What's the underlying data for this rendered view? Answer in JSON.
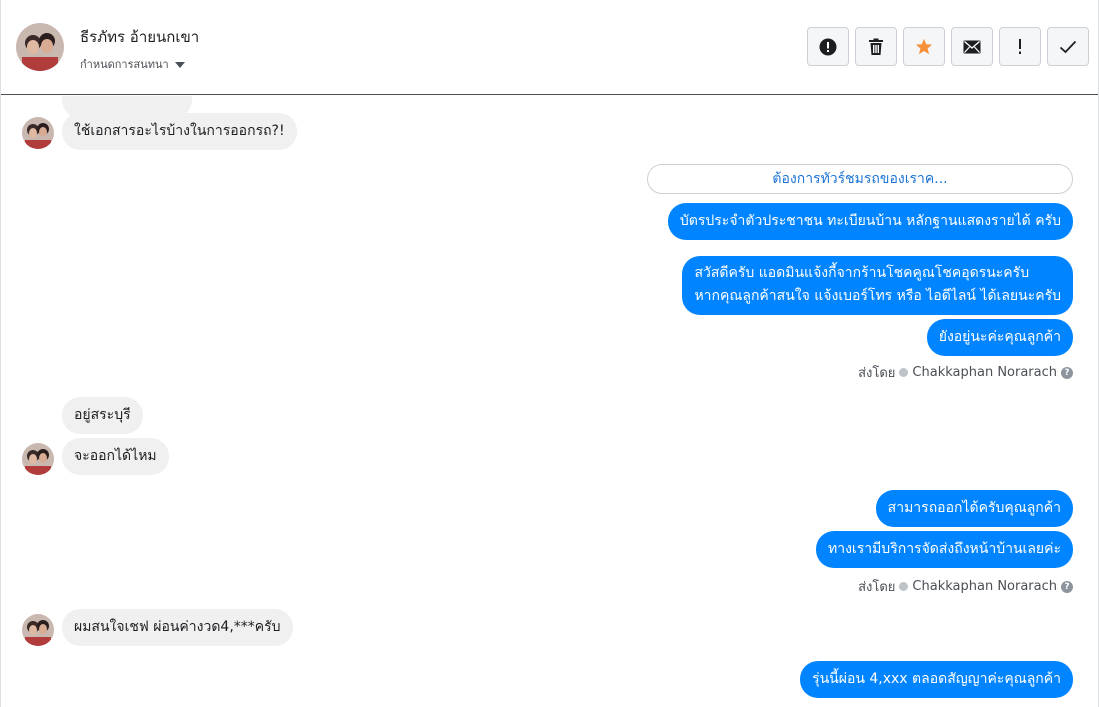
{
  "header": {
    "name": "ธีรภัทร อ้ายนกเขา",
    "subtitle": "กำหนดการสนทนา"
  },
  "toolbar": {
    "buttons": [
      {
        "icon": "alert-circle-icon",
        "label": "report"
      },
      {
        "icon": "trash-icon",
        "label": "delete"
      },
      {
        "icon": "star-icon",
        "label": "star",
        "color": "#f7923b"
      },
      {
        "icon": "envelope-icon",
        "label": "mark unread"
      },
      {
        "icon": "exclamation-icon",
        "label": "spam"
      },
      {
        "icon": "check-icon",
        "label": "done"
      }
    ]
  },
  "messages": {
    "partial_top": "…",
    "m1": "ใช้เอกสารอะไรบ้างในการออกรถ?!",
    "quick_reply": "ต้องการทัวร์ชมรถของเราค...",
    "m2": "บัตรประจำตัวประชาชน ทะเบียนบ้าน หลักฐานแสดงรายได้ ครับ",
    "m3_line1": "สวัสดีครับ แอดมินแจ้งกี้จากร้านโชคคูณโชคอุดรนะครับ",
    "m3_line2": "หากคุณลูกค้าสนใจ แจ้งเบอร์โทร หรือ ไอดีไลน์ ได้เลยนะครับ",
    "m4": "ยังอยู่นะค่ะคุณลูกค้า",
    "sentby1_prefix": "ส่งโดย",
    "sentby1_name": "Chakkaphan Norarach",
    "m5": "อยู่สระบุรี",
    "m6": "จะออกได้ไหม",
    "m7": "สามารถออกได้ครับคุณลูกค้า",
    "m8": "ทางเรามีบริการจัดส่งถึงหน้าบ้านเลยค่ะ",
    "sentby2_prefix": "ส่งโดย",
    "sentby2_name": "Chakkaphan Norarach",
    "m9": "ผมสนใจเชฟ ผ่อนค่างวด4,***ครับ",
    "m10": "รุ่นนี้ผ่อน 4,xxx ตลอดสัญญาค่ะคุณลูกค้า"
  },
  "colors": {
    "outgoing": "#0084ff",
    "incoming": "#f0f0f0",
    "star": "#f7923b"
  }
}
